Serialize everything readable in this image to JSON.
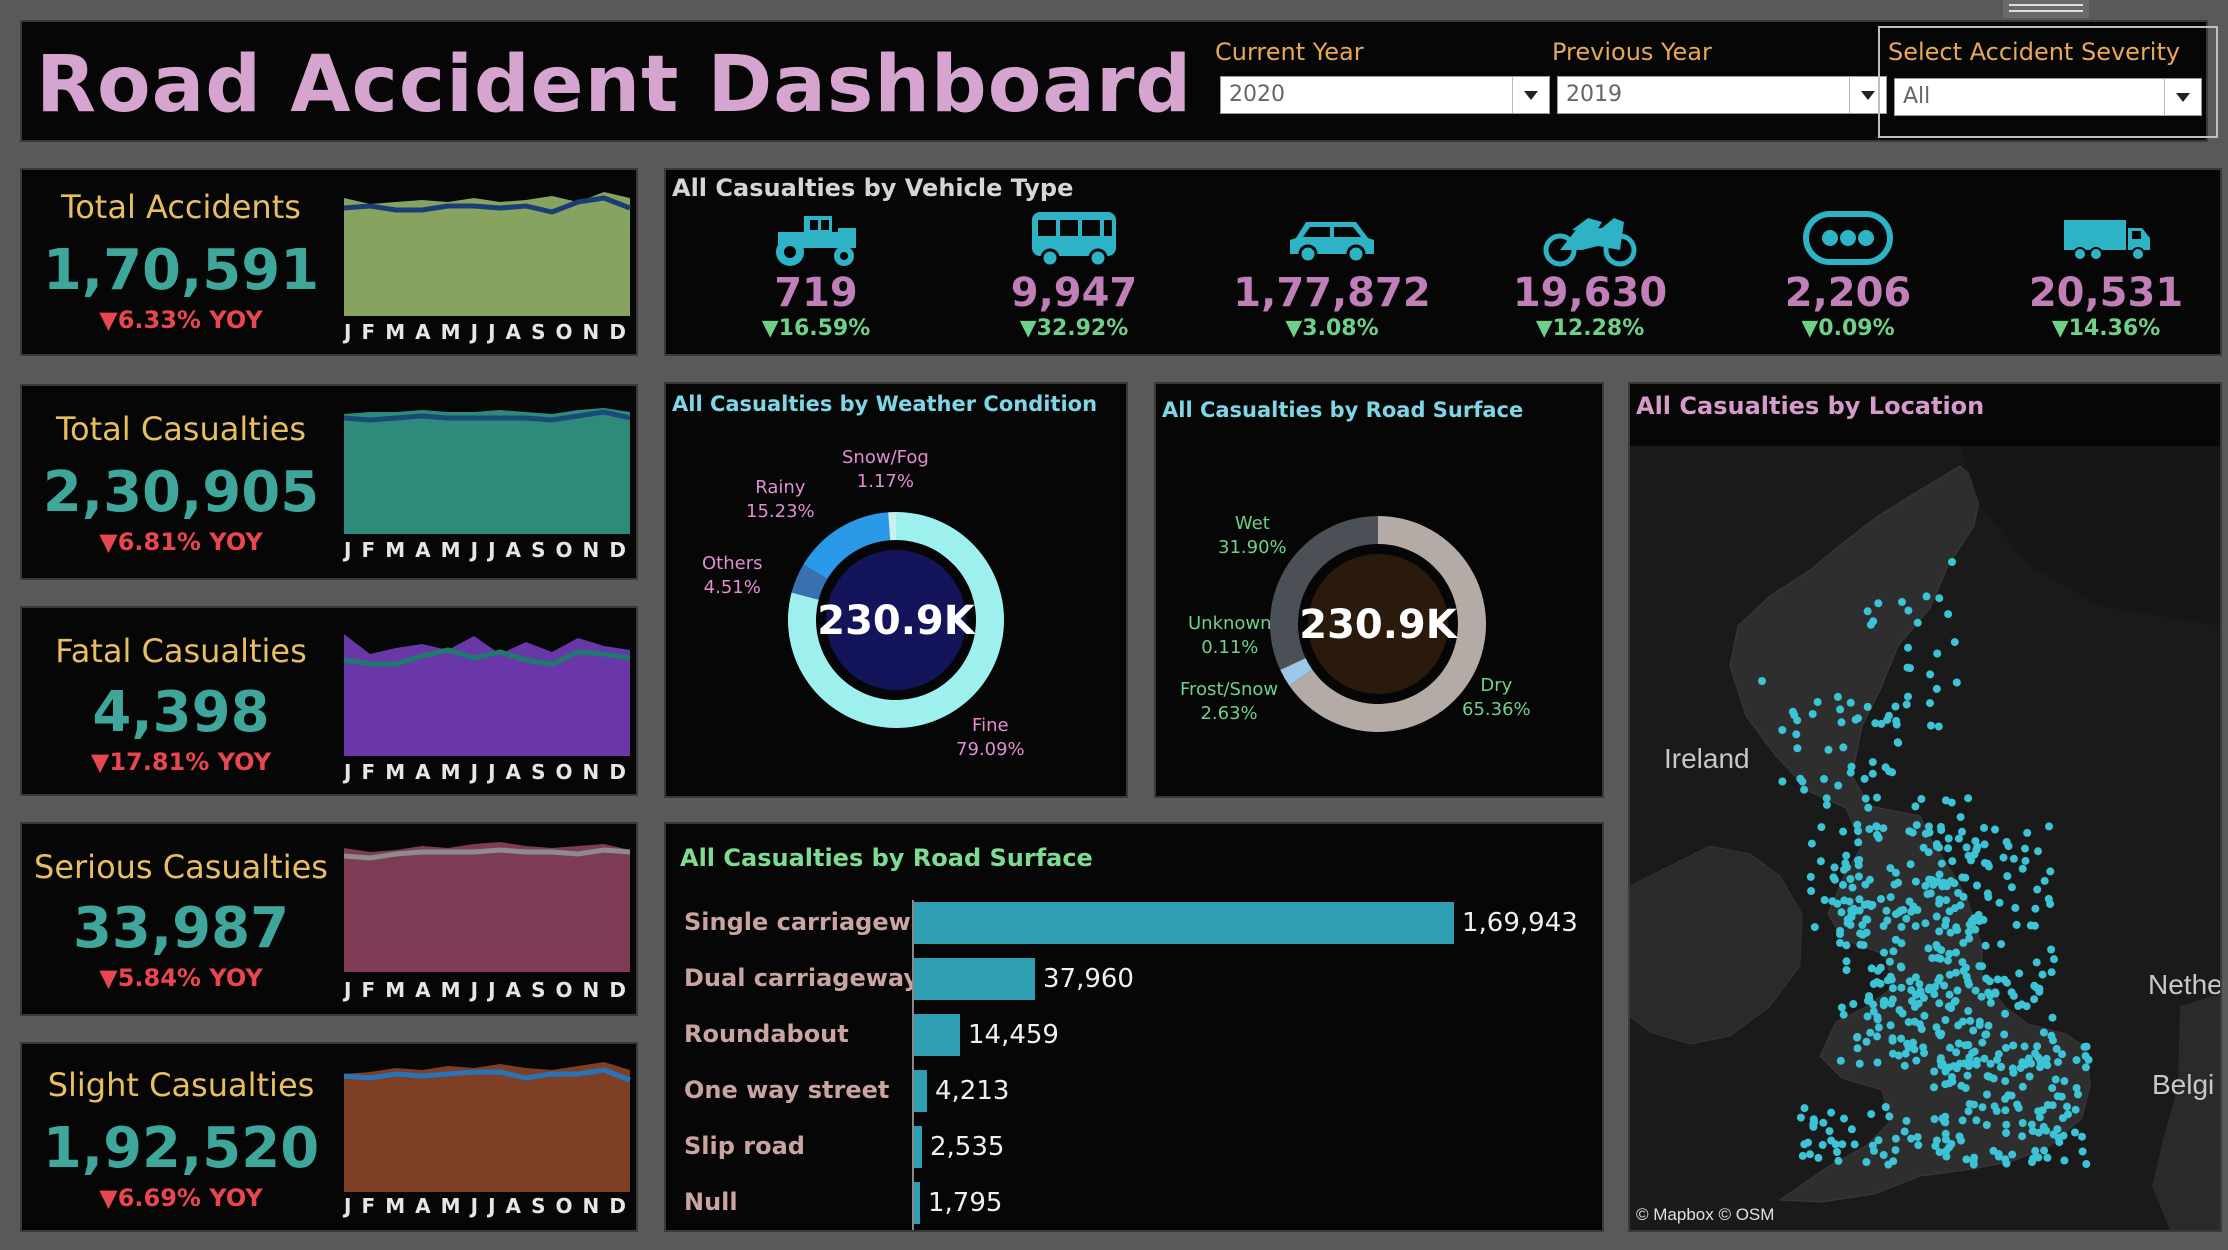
{
  "header": {
    "title": "Road Accident Dashboard",
    "filters": [
      {
        "label": "Current Year",
        "value": "2020"
      },
      {
        "label": "Previous Year",
        "value": "2019"
      },
      {
        "label": "Select Accident Severity",
        "value": "All"
      }
    ]
  },
  "kpis": [
    {
      "title": "Total Accidents",
      "value": "1,70,591",
      "yoy": "▼6.33% YOY"
    },
    {
      "title": "Total Casualties",
      "value": "2,30,905",
      "yoy": "▼6.81% YOY"
    },
    {
      "title": "Fatal Casualties",
      "value": "4,398",
      "yoy": "▼17.81% YOY"
    },
    {
      "title": "Serious Casualties",
      "value": "33,987",
      "yoy": "▼5.84% YOY"
    },
    {
      "title": "Slight Casualties",
      "value": "1,92,520",
      "yoy": "▼6.69% YOY"
    }
  ],
  "months": [
    "J",
    "F",
    "M",
    "A",
    "M",
    "J",
    "J",
    "A",
    "S",
    "O",
    "N",
    "D"
  ],
  "sparkline_colors": [
    {
      "fill": "#86a35f",
      "line": "#1a3d78"
    },
    {
      "fill": "#2e8a7a",
      "line": "#1c4a78"
    },
    {
      "fill": "#6a37a8",
      "line": "#1e7a6e"
    },
    {
      "fill": "#7e3b55",
      "line": "#8c8c8c"
    },
    {
      "fill": "#7e3f24",
      "line": "#2b73b8"
    }
  ],
  "vehicles": {
    "title": "All Casualties by Vehicle Type",
    "items": [
      {
        "icon": "tractor-icon",
        "value": "719",
        "pct": "▼16.59%"
      },
      {
        "icon": "bus-icon",
        "value": "9,947",
        "pct": "▼32.92%"
      },
      {
        "icon": "car-icon",
        "value": "1,77,872",
        "pct": "▼3.08%"
      },
      {
        "icon": "motorcycle-icon",
        "value": "19,630",
        "pct": "▼12.28%"
      },
      {
        "icon": "other-dots-icon",
        "value": "2,206",
        "pct": "▼0.09%"
      },
      {
        "icon": "truck-icon",
        "value": "20,531",
        "pct": "▼14.36%"
      }
    ]
  },
  "weather": {
    "title": "All Casualties by Weather Condition",
    "center": "230.9K",
    "slices": [
      {
        "name": "Fine",
        "pct": "79.09%",
        "value": 79.09,
        "color": "#9ef0ef"
      },
      {
        "name": "Others",
        "pct": "4.51%",
        "value": 4.51,
        "color": "#3a6fb0"
      },
      {
        "name": "Rainy",
        "pct": "15.23%",
        "value": 15.23,
        "color": "#2a9ae8"
      },
      {
        "name": "Snow/Fog",
        "pct": "1.17%",
        "value": 1.17,
        "color": "#c8f0f0"
      }
    ]
  },
  "surface": {
    "title": "All Casualties by Road Surface",
    "center": "230.9K",
    "slices": [
      {
        "name": "Dry",
        "pct": "65.36%",
        "value": 65.36,
        "color": "#b4aaa6"
      },
      {
        "name": "Frost/Snow",
        "pct": "2.63%",
        "value": 2.63,
        "color": "#9bc9e8"
      },
      {
        "name": "Unknown",
        "pct": "0.11%",
        "value": 0.11,
        "color": "#777777"
      },
      {
        "name": "Wet",
        "pct": "31.90%",
        "value": 31.9,
        "color": "#4b4f56"
      }
    ]
  },
  "road_type": {
    "title": "All Casualties by Road Surface",
    "items": [
      {
        "name": "Single carriageway",
        "label": "1,69,943",
        "value": 169943
      },
      {
        "name": "Dual carriageway",
        "label": "37,960",
        "value": 37960
      },
      {
        "name": "Roundabout",
        "label": "14,459",
        "value": 14459
      },
      {
        "name": "One way street",
        "label": "4,213",
        "value": 4213
      },
      {
        "name": "Slip road",
        "label": "2,535",
        "value": 2535
      },
      {
        "name": "Null",
        "label": "1,795",
        "value": 1795
      }
    ]
  },
  "map": {
    "title": "All Casualties by Location",
    "labels": {
      "ireland": "Ireland",
      "neth": "Nethe",
      "belg": "Belgi"
    },
    "attribution": "© Mapbox © OSM"
  },
  "chart_data": {
    "type": "bar",
    "title": "All Casualties by Road Surface",
    "categories": [
      "Single carriageway",
      "Dual carriageway",
      "Roundabout",
      "One way street",
      "Slip road",
      "Null"
    ],
    "values": [
      169943,
      37960,
      14459,
      4213,
      2535,
      1795
    ]
  }
}
